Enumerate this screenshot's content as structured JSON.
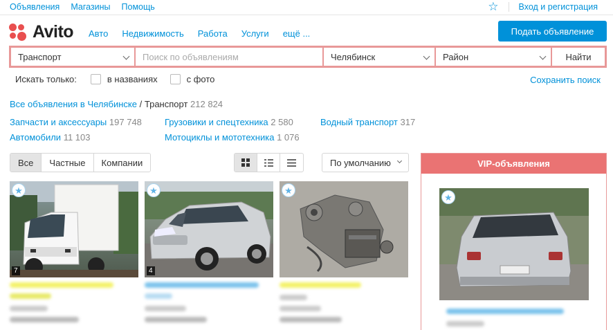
{
  "topbar": {
    "links": [
      "Объявления",
      "Магазины",
      "Помощь"
    ],
    "login": "Вход и регистрация"
  },
  "header": {
    "logo": "Avito",
    "nav": [
      "Авто",
      "Недвижимость",
      "Работа",
      "Услуги",
      "ещё ..."
    ],
    "post_button": "Подать объявление"
  },
  "search": {
    "category": "Транспорт",
    "query_placeholder": "Поиск по объявлениям",
    "city": "Челябинск",
    "district": "Район",
    "find_button": "Найти"
  },
  "filters": {
    "label": "Искать только:",
    "in_titles": "в названиях",
    "with_photo": "с фото",
    "save_search": "Сохранить поиск"
  },
  "breadcrumb": {
    "link": "Все объявления в Челябинске",
    "separator": "/",
    "current": "Транспорт",
    "count": "212 824"
  },
  "categories": [
    {
      "name": "Запчасти и аксессуары",
      "count": "197 748"
    },
    {
      "name": "Грузовики и спецтехника",
      "count": "2 580"
    },
    {
      "name": "Водный транспорт",
      "count": "317"
    },
    {
      "name": "Автомобили",
      "count": "11 103"
    },
    {
      "name": "Мотоциклы и мототехника",
      "count": "1 076"
    }
  ],
  "seller_filter": [
    "Все",
    "Частные",
    "Компании"
  ],
  "sort": "По умолчанию",
  "listings": [
    {
      "photo_count": "7",
      "icon": "truck"
    },
    {
      "photo_count": "4",
      "icon": "suv"
    },
    {
      "photo_count": "",
      "icon": "car-part"
    }
  ],
  "vip": {
    "title": "VIP-объявления"
  },
  "colors": {
    "accent": "#0091d9",
    "search_border": "#e89898",
    "vip_header": "#ea7373",
    "highlight": "#f4f26a"
  }
}
